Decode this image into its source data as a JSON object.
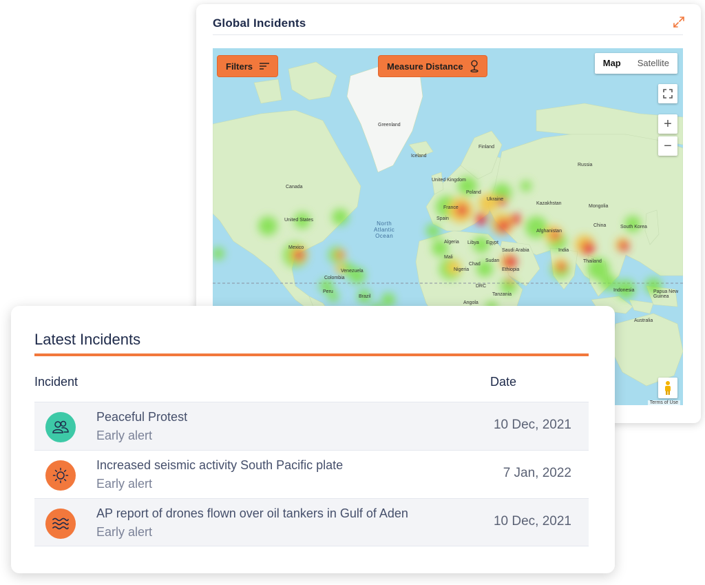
{
  "map_panel": {
    "title": "Global Incidents",
    "filters_label": "Filters",
    "measure_label": "Measure Distance",
    "map_types": [
      "Map",
      "Satellite"
    ],
    "active_map_type": "Map",
    "zoom_in": "+",
    "zoom_out": "−",
    "terms": "Terms of Use",
    "labels": {
      "greenland": "Greenland",
      "iceland": "Iceland",
      "finland": "Finland",
      "russia": "Russia",
      "canada": "Canada",
      "united_states": "United States",
      "mexico": "Mexico",
      "north_atlantic": "North\nAtlantic\nOcean",
      "united_kingdom": "United Kingdom",
      "poland": "Poland",
      "ukraine": "Ukraine",
      "france": "France",
      "spain": "Spain",
      "kazakhstan": "Kazakhstan",
      "mongolia": "Mongolia",
      "afghanistan": "Afghanistan",
      "china": "China",
      "south_korea": "South Korea",
      "algeria": "Algeria",
      "libya": "Libya",
      "egypt": "Egypt",
      "saudi_arabia": "Saudi Arabia",
      "india": "India",
      "thailand": "Thailand",
      "mali": "Mali",
      "chad": "Chad",
      "sudan": "Sudan",
      "nigeria": "Nigeria",
      "ethiopia": "Ethiopia",
      "drc": "DRC",
      "tanzania": "Tanzania",
      "angola": "Angola",
      "colombia": "Colombia",
      "venezuela": "Venezuela",
      "peru": "Peru",
      "brazil": "Brazil",
      "indonesia": "Indonesia",
      "papua_new_guinea": "Papua New\nGuinea",
      "australia": "Australia"
    }
  },
  "incidents_panel": {
    "title": "Latest Incidents",
    "col_incident": "Incident",
    "col_date": "Date",
    "rows": [
      {
        "name": "Peaceful Protest",
        "sub": "Early alert",
        "date": "10 Dec, 2021",
        "icon": "people-icon",
        "color": "#3dc9a7"
      },
      {
        "name": "Increased seismic activity South Pacific plate",
        "sub": "Early alert",
        "date": "7 Jan, 2022",
        "icon": "sun-icon",
        "color": "#f2783c"
      },
      {
        "name": "AP report of drones flown over oil tankers in Gulf of Aden",
        "sub": "Early alert",
        "date": "10 Dec, 2021",
        "icon": "waves-icon",
        "color": "#f2783c"
      }
    ]
  },
  "colors": {
    "accent": "#f2783c",
    "teal": "#3dc9a7",
    "ocean": "#a8dcee",
    "land": "#d8ecc5",
    "heat_hot": "#e8262a",
    "heat_warm": "#f4c23a",
    "heat_cool": "#7ee04a"
  }
}
